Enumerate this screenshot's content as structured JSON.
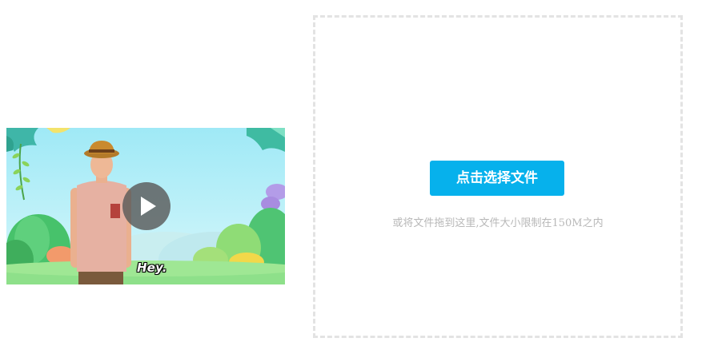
{
  "video": {
    "subtitle": "Hey.",
    "play_icon": "play-icon"
  },
  "upload": {
    "button_label": "点击选择文件",
    "hint": "或将文件拖到这里,文件大小限制在150M之内",
    "accent_color": "#06b1ec"
  }
}
